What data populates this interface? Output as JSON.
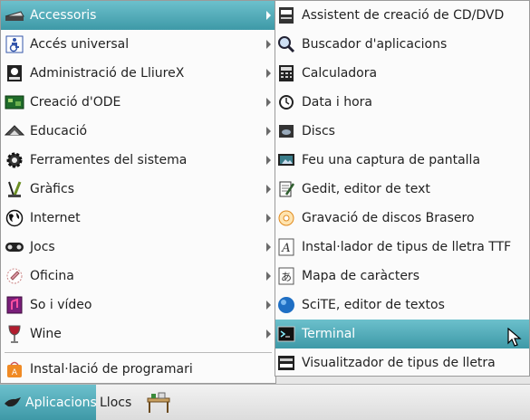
{
  "main_menu": {
    "items": [
      {
        "label": "Accessoris",
        "icon": "scanner-icon"
      },
      {
        "label": "Accés universal",
        "icon": "accessibility-icon"
      },
      {
        "label": "Administració de LliureX",
        "icon": "admin-icon"
      },
      {
        "label": "Creació d'ODE",
        "icon": "ode-icon"
      },
      {
        "label": "Educació",
        "icon": "education-icon"
      },
      {
        "label": "Ferramentes del sistema",
        "icon": "gear-icon"
      },
      {
        "label": "Gràfics",
        "icon": "graphics-icon"
      },
      {
        "label": "Internet",
        "icon": "globe-icon"
      },
      {
        "label": "Jocs",
        "icon": "gamepad-icon"
      },
      {
        "label": "Oficina",
        "icon": "office-icon"
      },
      {
        "label": "So i vídeo",
        "icon": "multimedia-icon"
      },
      {
        "label": "Wine",
        "icon": "wine-icon"
      },
      {
        "label": "Instal·lació de programari",
        "icon": "installer-icon"
      }
    ]
  },
  "sub_menu": {
    "items": [
      {
        "label": "Assistent de creació de CD/DVD",
        "icon": "cd-writer-icon"
      },
      {
        "label": "Buscador d'aplicacions",
        "icon": "magnifier-icon"
      },
      {
        "label": "Calculadora",
        "icon": "calculator-icon"
      },
      {
        "label": "Data i hora",
        "icon": "clock-icon"
      },
      {
        "label": "Discs",
        "icon": "disk-icon"
      },
      {
        "label": "Feu una captura de pantalla",
        "icon": "screenshot-icon"
      },
      {
        "label": "Gedit, editor de text",
        "icon": "text-editor-icon"
      },
      {
        "label": "Gravació de discos Brasero",
        "icon": "brasero-icon"
      },
      {
        "label": "Instal·lador de tipus de lletra TTF",
        "icon": "font-icon"
      },
      {
        "label": "Mapa de caràcters",
        "icon": "character-map-icon"
      },
      {
        "label": "SciTE, editor de textos",
        "icon": "scite-icon"
      },
      {
        "label": "Terminal",
        "icon": "terminal-icon"
      },
      {
        "label": "Visualitzador de tipus de lletra",
        "icon": "font-viewer-icon"
      }
    ]
  },
  "panel": {
    "apps_label": "Aplicacions",
    "places_label": "Llocs",
    "launcher_icon": "desk-icon"
  },
  "colors": {
    "selection": "#3e99a7",
    "menu_bg": "#fbfbfb"
  }
}
